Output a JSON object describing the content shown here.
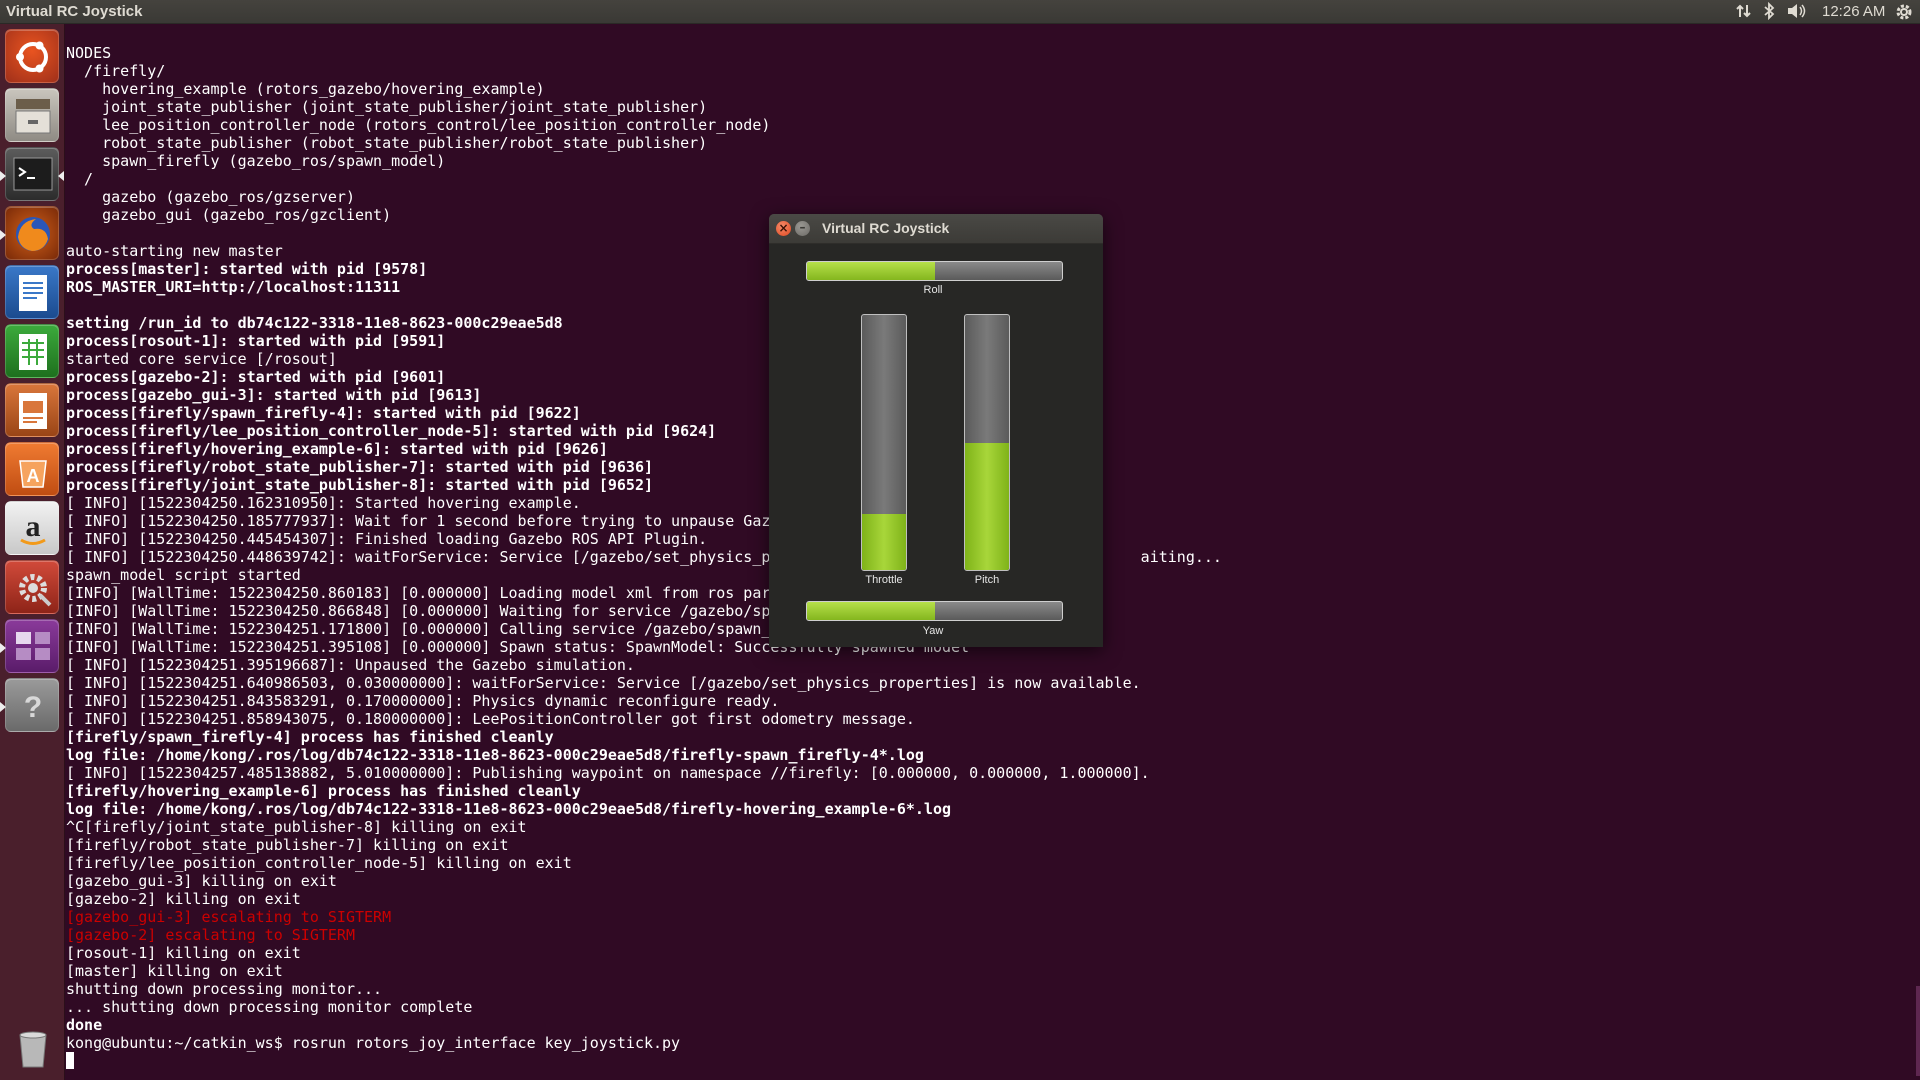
{
  "top_panel": {
    "title": "Virtual RC Joystick",
    "clock": "12:26 AM",
    "icons": [
      "network-arrows-icon",
      "bluetooth-icon",
      "volume-icon",
      "gear-icon"
    ]
  },
  "launcher": {
    "items": [
      {
        "name": "ubuntu-dash",
        "icon": "ubuntu-logo-icon"
      },
      {
        "name": "files",
        "icon": "file-cabinet-icon"
      },
      {
        "name": "terminal",
        "icon": "terminal-icon"
      },
      {
        "name": "firefox",
        "icon": "firefox-icon"
      },
      {
        "name": "libreoffice-writer",
        "icon": "writer-icon"
      },
      {
        "name": "libreoffice-calc",
        "icon": "calc-icon"
      },
      {
        "name": "libreoffice-impress",
        "icon": "impress-icon"
      },
      {
        "name": "ubuntu-software",
        "icon": "software-center-icon"
      },
      {
        "name": "amazon",
        "icon": "amazon-icon"
      },
      {
        "name": "system-settings",
        "icon": "settings-icon"
      },
      {
        "name": "workspaces",
        "icon": "workspace-switcher-icon"
      },
      {
        "name": "help",
        "icon": "help-icon"
      },
      {
        "name": "trash",
        "icon": "trash-icon"
      }
    ]
  },
  "terminal": {
    "lines": [
      {
        "text": "NODES",
        "style": "n"
      },
      {
        "text": "  /firefly/",
        "style": "n"
      },
      {
        "text": "    hovering_example (rotors_gazebo/hovering_example)",
        "style": "n"
      },
      {
        "text": "    joint_state_publisher (joint_state_publisher/joint_state_publisher)",
        "style": "n"
      },
      {
        "text": "    lee_position_controller_node (rotors_control/lee_position_controller_node)",
        "style": "n"
      },
      {
        "text": "    robot_state_publisher (robot_state_publisher/robot_state_publisher)",
        "style": "n"
      },
      {
        "text": "    spawn_firefly (gazebo_ros/spawn_model)",
        "style": "n"
      },
      {
        "text": "  /",
        "style": "n"
      },
      {
        "text": "    gazebo (gazebo_ros/gzserver)",
        "style": "n"
      },
      {
        "text": "    gazebo_gui (gazebo_ros/gzclient)",
        "style": "n"
      },
      {
        "text": "",
        "style": "n"
      },
      {
        "text": "auto-starting new master",
        "style": "n"
      },
      {
        "text": "process[master]: started with pid [9578]",
        "style": "b"
      },
      {
        "text": "ROS_MASTER_URI=http://localhost:11311",
        "style": "b"
      },
      {
        "text": "",
        "style": "n"
      },
      {
        "text": "setting /run_id to db74c122-3318-11e8-8623-000c29eae5d8",
        "style": "b"
      },
      {
        "text": "process[rosout-1]: started with pid [9591]",
        "style": "b"
      },
      {
        "text": "started core service [/rosout]",
        "style": "n"
      },
      {
        "text": "process[gazebo-2]: started with pid [9601]",
        "style": "b"
      },
      {
        "text": "process[gazebo_gui-3]: started with pid [9613]",
        "style": "b"
      },
      {
        "text": "process[firefly/spawn_firefly-4]: started with pid [9622]",
        "style": "b"
      },
      {
        "text": "process[firefly/lee_position_controller_node-5]: started with pid [9624]",
        "style": "b"
      },
      {
        "text": "process[firefly/hovering_example-6]: started with pid [9626]",
        "style": "b"
      },
      {
        "text": "process[firefly/robot_state_publisher-7]: started with pid [9636]",
        "style": "b"
      },
      {
        "text": "process[firefly/joint_state_publisher-8]: started with pid [9652]",
        "style": "b"
      },
      {
        "text": "[ INFO] [1522304250.162310950]: Started hovering example.",
        "style": "n"
      },
      {
        "text": "[ INFO] [1522304250.185777937]: Wait for 1 second before trying to unpause Gaz",
        "style": "n"
      },
      {
        "text": "[ INFO] [1522304250.445454307]: Finished loading Gazebo ROS API Plugin.",
        "style": "n"
      },
      {
        "text": "[ INFO] [1522304250.448639742]: waitForService: Service [/gazebo/set_physics_p                                         aiting...",
        "style": "n"
      },
      {
        "text": "spawn_model script started",
        "style": "n"
      },
      {
        "text": "[INFO] [WallTime: 1522304250.860183] [0.000000] Loading model xml from ros par",
        "style": "n"
      },
      {
        "text": "[INFO] [WallTime: 1522304250.866848] [0.000000] Waiting for service /gazebo/sp",
        "style": "n"
      },
      {
        "text": "[INFO] [WallTime: 1522304251.171800] [0.000000] Calling service /gazebo/spawn_",
        "style": "n"
      },
      {
        "text": "[INFO] [WallTime: 1522304251.395108] [0.000000] Spawn status: SpawnModel: Successfully spawned model",
        "style": "n"
      },
      {
        "text": "[ INFO] [1522304251.395196687]: Unpaused the Gazebo simulation.",
        "style": "n"
      },
      {
        "text": "[ INFO] [1522304251.640986503, 0.030000000]: waitForService: Service [/gazebo/set_physics_properties] is now available.",
        "style": "n"
      },
      {
        "text": "[ INFO] [1522304251.843583291, 0.170000000]: Physics dynamic reconfigure ready.",
        "style": "n"
      },
      {
        "text": "[ INFO] [1522304251.858943075, 0.180000000]: LeePositionController got first odometry message.",
        "style": "n"
      },
      {
        "text": "[firefly/spawn_firefly-4] process has finished cleanly",
        "style": "b"
      },
      {
        "text": "log file: /home/kong/.ros/log/db74c122-3318-11e8-8623-000c29eae5d8/firefly-spawn_firefly-4*.log",
        "style": "b"
      },
      {
        "text": "[ INFO] [1522304257.485138882, 5.010000000]: Publishing waypoint on namespace //firefly: [0.000000, 0.000000, 1.000000].",
        "style": "n"
      },
      {
        "text": "[firefly/hovering_example-6] process has finished cleanly",
        "style": "b"
      },
      {
        "text": "log file: /home/kong/.ros/log/db74c122-3318-11e8-8623-000c29eae5d8/firefly-hovering_example-6*.log",
        "style": "b"
      },
      {
        "text": "^C[firefly/joint_state_publisher-8] killing on exit",
        "style": "n"
      },
      {
        "text": "[firefly/robot_state_publisher-7] killing on exit",
        "style": "n"
      },
      {
        "text": "[firefly/lee_position_controller_node-5] killing on exit",
        "style": "n"
      },
      {
        "text": "[gazebo_gui-3] killing on exit",
        "style": "n"
      },
      {
        "text": "[gazebo-2] killing on exit",
        "style": "n"
      },
      {
        "text": "[gazebo_gui-3] escalating to SIGTERM",
        "style": "r"
      },
      {
        "text": "[gazebo-2] escalating to SIGTERM",
        "style": "r"
      },
      {
        "text": "[rosout-1] killing on exit",
        "style": "n"
      },
      {
        "text": "[master] killing on exit",
        "style": "n"
      },
      {
        "text": "shutting down processing monitor...",
        "style": "n"
      },
      {
        "text": "... shutting down processing monitor complete",
        "style": "n"
      },
      {
        "text": "done",
        "style": "b"
      },
      {
        "text": "kong@ubuntu:~/catkin_ws$ rosrun rotors_joy_interface key_joystick.py",
        "style": "n"
      }
    ]
  },
  "joystick": {
    "title": "Virtual RC Joystick",
    "roll": {
      "label": "Roll",
      "value": 0.5
    },
    "throttle": {
      "label": "Throttle",
      "value": 0.22
    },
    "pitch": {
      "label": "Pitch",
      "value": 0.5
    },
    "yaw": {
      "label": "Yaw",
      "value": 0.5
    }
  },
  "colors": {
    "terminal_bg": "#300a24",
    "bar_fill": "#9acd32",
    "error_text": "#cc0000"
  }
}
